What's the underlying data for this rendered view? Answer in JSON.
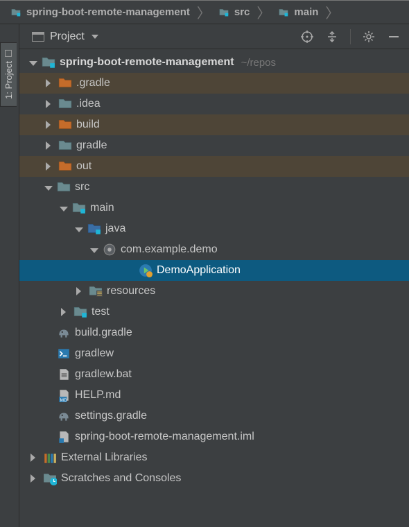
{
  "breadcrumb": {
    "root": "spring-boot-remote-management",
    "mid": "src",
    "leaf": "main"
  },
  "gutter": {
    "tab_label": "1: Project"
  },
  "panel": {
    "title": "Project"
  },
  "tree": {
    "root_name": "spring-boot-remote-management",
    "root_hint": "~/repos",
    "items": [
      {
        "label": ".gradle"
      },
      {
        "label": ".idea"
      },
      {
        "label": "build"
      },
      {
        "label": "gradle"
      },
      {
        "label": "out"
      },
      {
        "label": "src"
      },
      {
        "label": "main"
      },
      {
        "label": "java"
      },
      {
        "label": "com.example.demo"
      },
      {
        "label": "DemoApplication"
      },
      {
        "label": "resources"
      },
      {
        "label": "test"
      },
      {
        "label": "build.gradle"
      },
      {
        "label": "gradlew"
      },
      {
        "label": "gradlew.bat"
      },
      {
        "label": "HELP.md"
      },
      {
        "label": "settings.gradle"
      },
      {
        "label": "spring-boot-remote-management.iml"
      },
      {
        "label": "External Libraries"
      },
      {
        "label": "Scratches and Consoles"
      }
    ]
  }
}
